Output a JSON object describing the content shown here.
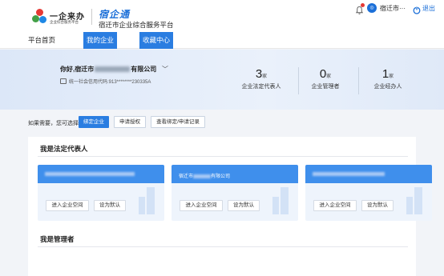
{
  "header": {
    "logo_main": "一企来办",
    "logo_sub": "企业综合服务平台",
    "brand_title": "宿企通",
    "brand_subtitle": "宿迁市企业综合服务平台",
    "user_name": "宿迁市···",
    "logout": "退出"
  },
  "nav": {
    "items": [
      {
        "label": "平台首页"
      },
      {
        "label": "我的企业"
      },
      {
        "label": "收藏中心"
      }
    ]
  },
  "banner": {
    "greeting_prefix": "你好,宿迁市",
    "greeting_suffix": "有限公司",
    "credit_code": "统一社会信用代码:913********230335A",
    "stats": [
      {
        "value": "3",
        "unit": "家",
        "label": "企业法定代表人"
      },
      {
        "value": "0",
        "unit": "家",
        "label": "企业管理者"
      },
      {
        "value": "1",
        "unit": "家",
        "label": "企业经办人"
      }
    ]
  },
  "actions": {
    "tip": "如果需要，您可选择",
    "bind": "绑定企业",
    "apply": "申请授权",
    "records": "查看绑定/申请记录"
  },
  "sections": {
    "legal_rep": "我是法定代表人",
    "manager": "我是管理者"
  },
  "cards": [
    {
      "name_visible": "",
      "enter": "进入企业空间",
      "default": "设为默认"
    },
    {
      "name_visible": "宿迁市",
      "name_tail": "有限公司",
      "enter": "进入企业空间",
      "default": "设为默认"
    },
    {
      "name_visible": "",
      "enter": "进入企业空间",
      "default": "设为默认"
    }
  ],
  "colors": {
    "accent": "#2a7de1",
    "brand": "#1b6fd8",
    "card_header": "#3f8fec"
  }
}
